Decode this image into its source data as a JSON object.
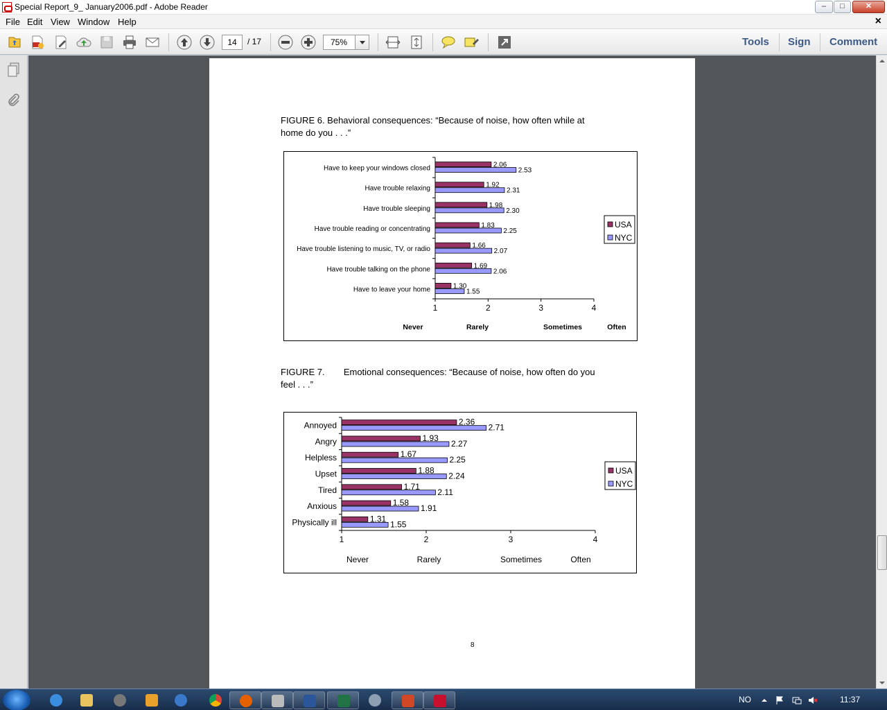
{
  "window": {
    "title": "Special Report_9_ January2006.pdf - Adobe Reader",
    "min_label": "–",
    "max_label": "□",
    "close_label": "✕"
  },
  "menu": {
    "items": [
      "File",
      "Edit",
      "View",
      "Window",
      "Help"
    ],
    "close_glyph": "×"
  },
  "toolbar": {
    "page_current": "14",
    "page_total": "/ 17",
    "zoom": "75%",
    "links": [
      "Tools",
      "Sign",
      "Comment"
    ]
  },
  "document": {
    "fig6_title_line1": "FIGURE 6.  Behavioral consequences: “Because of noise, how often while at",
    "fig6_title_line2": "home do you . . .”",
    "fig7_title_prefix": "FIGURE 7.",
    "fig7_title_line1": "Emotional consequences:  “Because of noise, how often do you",
    "fig7_title_line2": "feel . . .”",
    "page_number": "8"
  },
  "chart_data": [
    {
      "type": "bar",
      "orientation": "horizontal",
      "categories": [
        "Have to keep your windows closed",
        "Have trouble relaxing",
        "Have trouble sleeping",
        "Have trouble reading or concentrating",
        "Have trouble listening to music, TV, or radio",
        "Have trouble talking on the phone",
        "Have to leave your home"
      ],
      "series": [
        {
          "name": "USA",
          "values": [
            2.06,
            1.92,
            1.98,
            1.83,
            1.66,
            1.69,
            1.3
          ],
          "color": "#993366"
        },
        {
          "name": "NYC",
          "values": [
            2.53,
            2.31,
            2.3,
            2.25,
            2.07,
            2.06,
            1.55
          ],
          "color": "#9999ff"
        }
      ],
      "value_labels": {
        "USA": [
          "2.06",
          "1.92",
          "1.98",
          "1.83",
          "1.66",
          "1.69",
          "1.30"
        ],
        "NYC": [
          "2.53",
          "2.31",
          "2.30",
          "2.25",
          "2.07",
          "2.06",
          "1.55"
        ]
      },
      "xlim": [
        1,
        4
      ],
      "xticks": [
        "1",
        "2",
        "3",
        "4"
      ],
      "scale_labels": [
        "Never",
        "Rarely",
        "Sometimes",
        "Often"
      ],
      "legend": "right",
      "grid": false
    },
    {
      "type": "bar",
      "orientation": "horizontal",
      "categories": [
        "Annoyed",
        "Angry",
        "Helpless",
        "Upset",
        "Tired",
        "Anxious",
        "Physically ill"
      ],
      "series": [
        {
          "name": "USA",
          "values": [
            2.36,
            1.93,
            1.67,
            1.88,
            1.71,
            1.58,
            1.31
          ],
          "color": "#993366"
        },
        {
          "name": "NYC",
          "values": [
            2.71,
            2.27,
            2.25,
            2.24,
            2.11,
            1.91,
            1.55
          ],
          "color": "#9999ff"
        }
      ],
      "value_labels": {
        "USA": [
          "2.36",
          "1.93",
          "1.67",
          "1.88",
          "1.71",
          "1.58",
          "1.31"
        ],
        "NYC": [
          "2.71",
          "2.27",
          "2.25",
          "2.24",
          "2.11",
          "1.91",
          "1.55"
        ]
      },
      "xlim": [
        1,
        4
      ],
      "xticks": [
        "1",
        "2",
        "3",
        "4"
      ],
      "scale_labels": [
        "Never",
        "Rarely",
        "Sometimes",
        "Often"
      ],
      "legend": "right",
      "grid": false
    }
  ],
  "taskbar": {
    "language": "NO",
    "clock": "11:37"
  }
}
